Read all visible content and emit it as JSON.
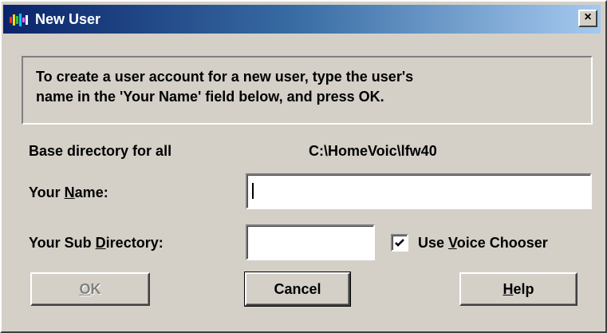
{
  "window": {
    "title": "New User",
    "close_label": "×"
  },
  "info": {
    "line1": "To create a user account for a new user, type the user's",
    "line2": "name in the 'Your Name' field below, and press OK."
  },
  "base_dir": {
    "label": "Base directory for all",
    "value": "C:\\HomeVoic\\lfw40"
  },
  "your_name": {
    "label_before": "Your ",
    "label_accel": "N",
    "label_after": "ame:",
    "value": ""
  },
  "sub_dir": {
    "label_before": "Your Sub ",
    "label_accel": "D",
    "label_after": "irectory:",
    "value": ""
  },
  "voice_chooser": {
    "label_before": "Use ",
    "label_accel": "V",
    "label_after": "oice Chooser",
    "checked": true
  },
  "buttons": {
    "ok_accel": "O",
    "ok_after": "K",
    "cancel": "Cancel",
    "help_accel": "H",
    "help_after": "elp"
  },
  "icons": {
    "app": "app-icon",
    "close": "close-icon",
    "check": "checkmark-icon"
  }
}
